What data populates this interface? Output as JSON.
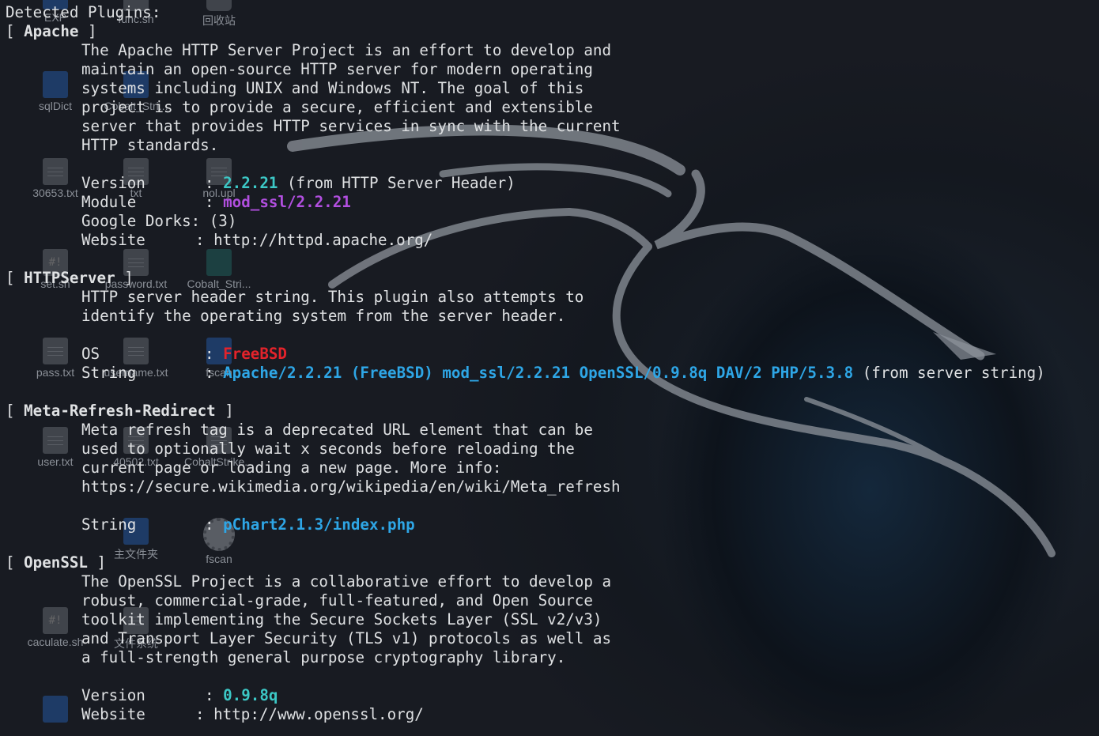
{
  "desktop_icons": [
    {
      "name": "EXP",
      "kind": "folder"
    },
    {
      "name": "func.sh",
      "kind": "sh"
    },
    {
      "name": "回收站",
      "kind": "trash"
    },
    {
      "name": "sqlDict",
      "kind": "folder"
    },
    {
      "name": "Cobalt_Stri...",
      "kind": "folder"
    },
    {
      "name": "30653.txt",
      "kind": "doc"
    },
    {
      "name": "txt",
      "kind": "doc"
    },
    {
      "name": "nol.upl",
      "kind": "doc"
    },
    {
      "name": "set.sh",
      "kind": "sh"
    },
    {
      "name": "password.txt",
      "kind": "doc"
    },
    {
      "name": "Cobalt_Stri...",
      "kind": "zip"
    },
    {
      "name": "pass.txt",
      "kind": "doc"
    },
    {
      "name": "username.txt",
      "kind": "doc"
    },
    {
      "name": "fscan",
      "kind": "folder"
    },
    {
      "name": "user.txt",
      "kind": "doc"
    },
    {
      "name": "40502.txt",
      "kind": "doc"
    },
    {
      "name": "CobaltStrike...",
      "kind": "doc"
    },
    {
      "name": "主文件夹",
      "kind": "folder"
    },
    {
      "name": "fscan",
      "kind": "gear"
    },
    {
      "name": "caculate.sh",
      "kind": "sh"
    },
    {
      "name": "文件系统",
      "kind": "drive"
    }
  ],
  "terminal": {
    "header": "Detected Plugins:",
    "plugins": [
      {
        "name": "Apache",
        "description": [
          "The Apache HTTP Server Project is an effort to develop and",
          "maintain an open-source HTTP server for modern operating",
          "systems including UNIX and Windows NT. The goal of this",
          "project is to provide a secure, efficient and extensible",
          "server that provides HTTP services in sync with the current",
          "HTTP standards."
        ],
        "fields": {
          "version_label": "Version",
          "version_value": "2.2.21",
          "version_note": "(from HTTP Server Header)",
          "module_label": "Module",
          "module_value": "mod_ssl/2.2.21",
          "dorks_text": "Google Dorks: (3)",
          "website_label": "Website",
          "website_value": "http://httpd.apache.org/"
        }
      },
      {
        "name": "HTTPServer",
        "description": [
          "HTTP server header string. This plugin also attempts to",
          "identify the operating system from the server header."
        ],
        "fields": {
          "os_label": "OS",
          "os_value": "FreeBSD",
          "string_label": "String",
          "string_value": "Apache/2.2.21 (FreeBSD) mod_ssl/2.2.21 OpenSSL/0.9.8q DAV/2 PHP/5.3.8",
          "string_note": "(from server string)"
        }
      },
      {
        "name": "Meta-Refresh-Redirect",
        "description": [
          "Meta refresh tag is a deprecated URL element that can be",
          "used to optionally wait x seconds before reloading the",
          "current page or loading a new page. More info:",
          "https://secure.wikimedia.org/wikipedia/en/wiki/Meta_refresh"
        ],
        "fields": {
          "string_label": "String",
          "string_value": "pChart2.1.3/index.php"
        }
      },
      {
        "name": "OpenSSL",
        "description": [
          "The OpenSSL Project is a collaborative effort to develop a",
          "robust, commercial-grade, full-featured, and Open Source",
          "toolkit implementing the Secure Sockets Layer (SSL v2/v3)",
          "and Transport Layer Security (TLS v1) protocols as well as",
          "a full-strength general purpose cryptography library."
        ],
        "fields": {
          "version_label": "Version",
          "version_value": "0.9.8q",
          "website_label": "Website",
          "website_value": "http://www.openssl.org/"
        }
      }
    ]
  },
  "colors": {
    "text": "#dfe1e3",
    "version": "#3cc8c6",
    "module": "#b24fe0",
    "os": "#e3232b",
    "string": "#2ea6e6",
    "background": "#181b22"
  }
}
